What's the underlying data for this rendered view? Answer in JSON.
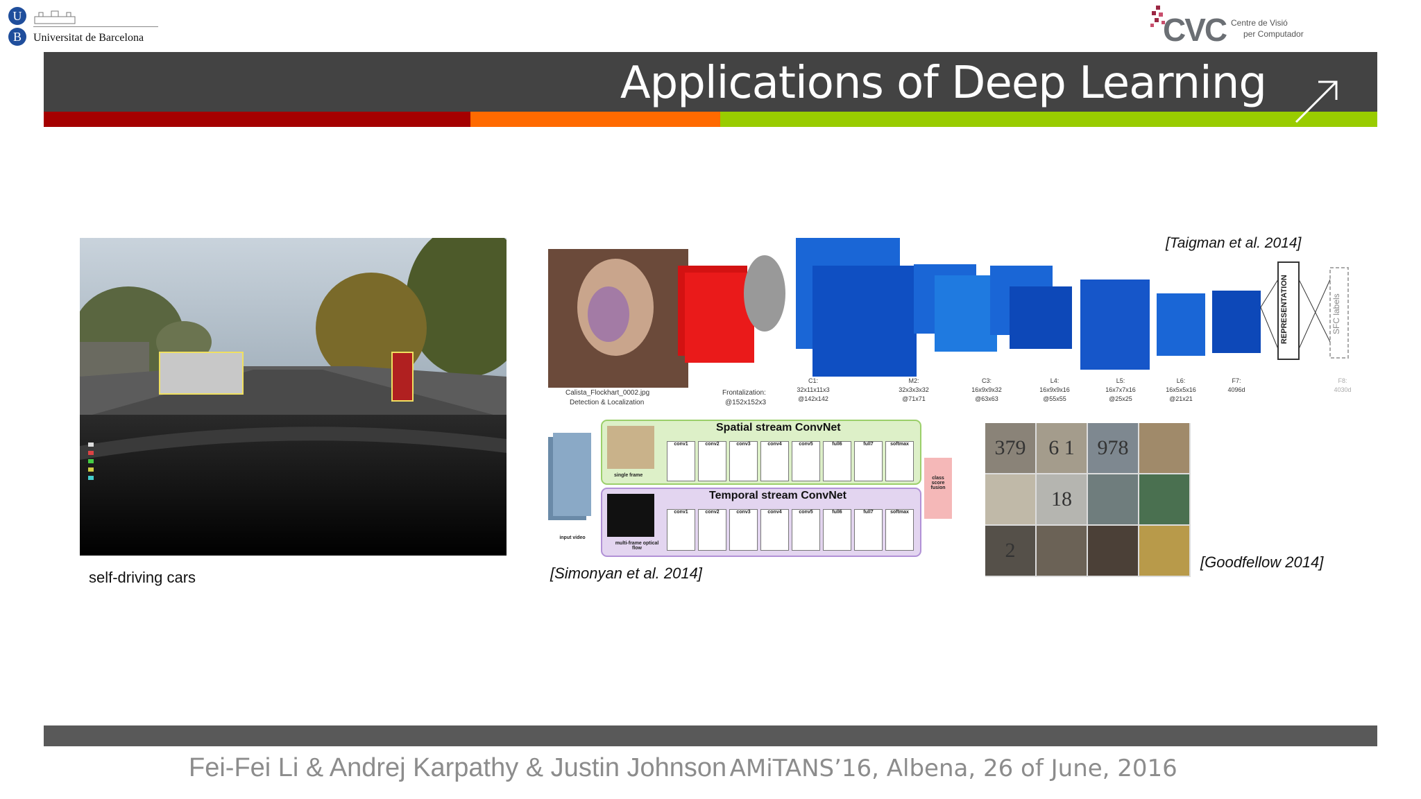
{
  "header": {
    "ub_logo": {
      "letters": [
        "U",
        "B"
      ],
      "name": "Universitat de Barcelona"
    },
    "cvc_logo": {
      "mark": "CVC",
      "line1": "Centre de Visió",
      "line2": "per Computador"
    }
  },
  "slide": {
    "title": "Applications of Deep Learning",
    "stripe_colors": [
      "#a50000",
      "#ff6a00",
      "#99cc00"
    ],
    "title_bar_color": "#434343",
    "arrow_icon": "arrow-up-right-icon"
  },
  "figures": {
    "self_driving": {
      "caption": "self-driving cars"
    },
    "face": {
      "citation": "[Taigman et al. 2014]",
      "input_caption_1": "Calista_Flockhart_0002.jpg",
      "input_caption_2": "Detection & Localization",
      "frontal_caption_1": "Frontalization:",
      "frontal_caption_2": "@152x152x3",
      "layers": [
        {
          "name": "C1:",
          "dims": "32x11x11x3",
          "size": "@142x142"
        },
        {
          "name": "M2:",
          "dims": "32x3x3x32",
          "size": "@71x71"
        },
        {
          "name": "C3:",
          "dims": "16x9x9x32",
          "size": "@63x63"
        },
        {
          "name": "L4:",
          "dims": "16x9x9x16",
          "size": "@55x55"
        },
        {
          "name": "L5:",
          "dims": "16x7x7x16",
          "size": "@25x25"
        },
        {
          "name": "L6:",
          "dims": "16x5x5x16",
          "size": "@21x21"
        },
        {
          "name": "F7:",
          "dims": "4096d",
          "size": ""
        },
        {
          "name": "F8:",
          "dims": "4030d",
          "size": ""
        }
      ],
      "representation_label": "REPRESENTATION",
      "sfc_label": "SFC labels"
    },
    "video": {
      "citation": "[Simonyan et al. 2014]",
      "spatial_title": "Spatial stream ConvNet",
      "temporal_title": "Temporal stream ConvNet",
      "input_label": "input video",
      "single_frame": "single frame",
      "multi_frame": "multi-frame optical flow",
      "fusion_label": "class score fusion",
      "spatial_layers": [
        "conv1",
        "conv2",
        "conv3",
        "conv4",
        "conv5",
        "full6",
        "full7",
        "softmax"
      ],
      "temporal_layers": [
        "conv1",
        "conv2",
        "conv3",
        "conv4",
        "conv5",
        "full6",
        "full7",
        "softmax"
      ]
    },
    "digits": {
      "citation": "[Goodfellow 2014]",
      "cells": [
        "379",
        "6 1",
        "978",
        "",
        "",
        "18",
        "",
        "",
        "2",
        "",
        "",
        ""
      ]
    }
  },
  "footer": {
    "authors": "Fei-Fei Li & Andrej Karpathy & Justin Johnson",
    "event": "AMiTANS’16, Albena, 26 of June, 2016",
    "bar_color": "#595959"
  }
}
